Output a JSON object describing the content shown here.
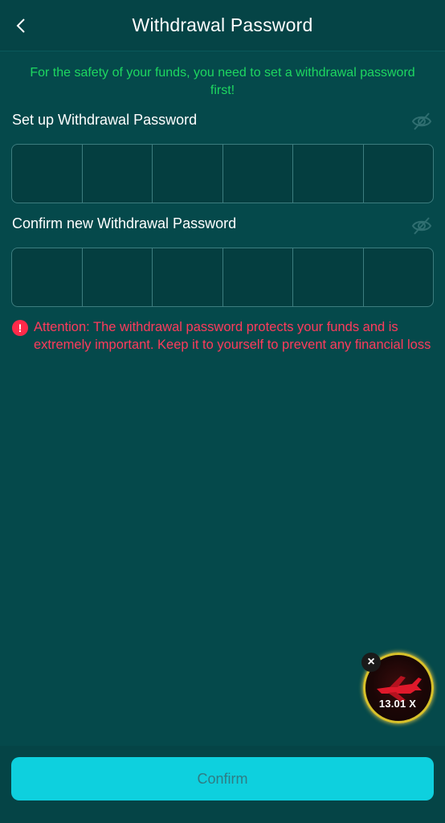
{
  "header": {
    "title": "Withdrawal Password",
    "back_icon": "chevron-left-icon"
  },
  "notice": "For the safety of your funds, you need to set a withdrawal password first!",
  "fields": [
    {
      "label": "Set up Withdrawal Password",
      "visibility_icon": "eye-off-icon",
      "digits": 6
    },
    {
      "label": "Confirm new Withdrawal Password",
      "visibility_icon": "eye-off-icon",
      "digits": 6
    }
  ],
  "attention": {
    "icon": "exclamation-circle-icon",
    "text": "Attention: The withdrawal password protects your funds and is extremely important. Keep it to yourself to prevent any financial loss"
  },
  "floating_widget": {
    "close_label": "×",
    "multiplier": "13.01 X"
  },
  "footer": {
    "confirm_label": "Confirm"
  },
  "colors": {
    "background": "#05494b",
    "notice": "#1ed760",
    "attention": "#ff3b5c",
    "confirm_button": "#0ed0de"
  }
}
